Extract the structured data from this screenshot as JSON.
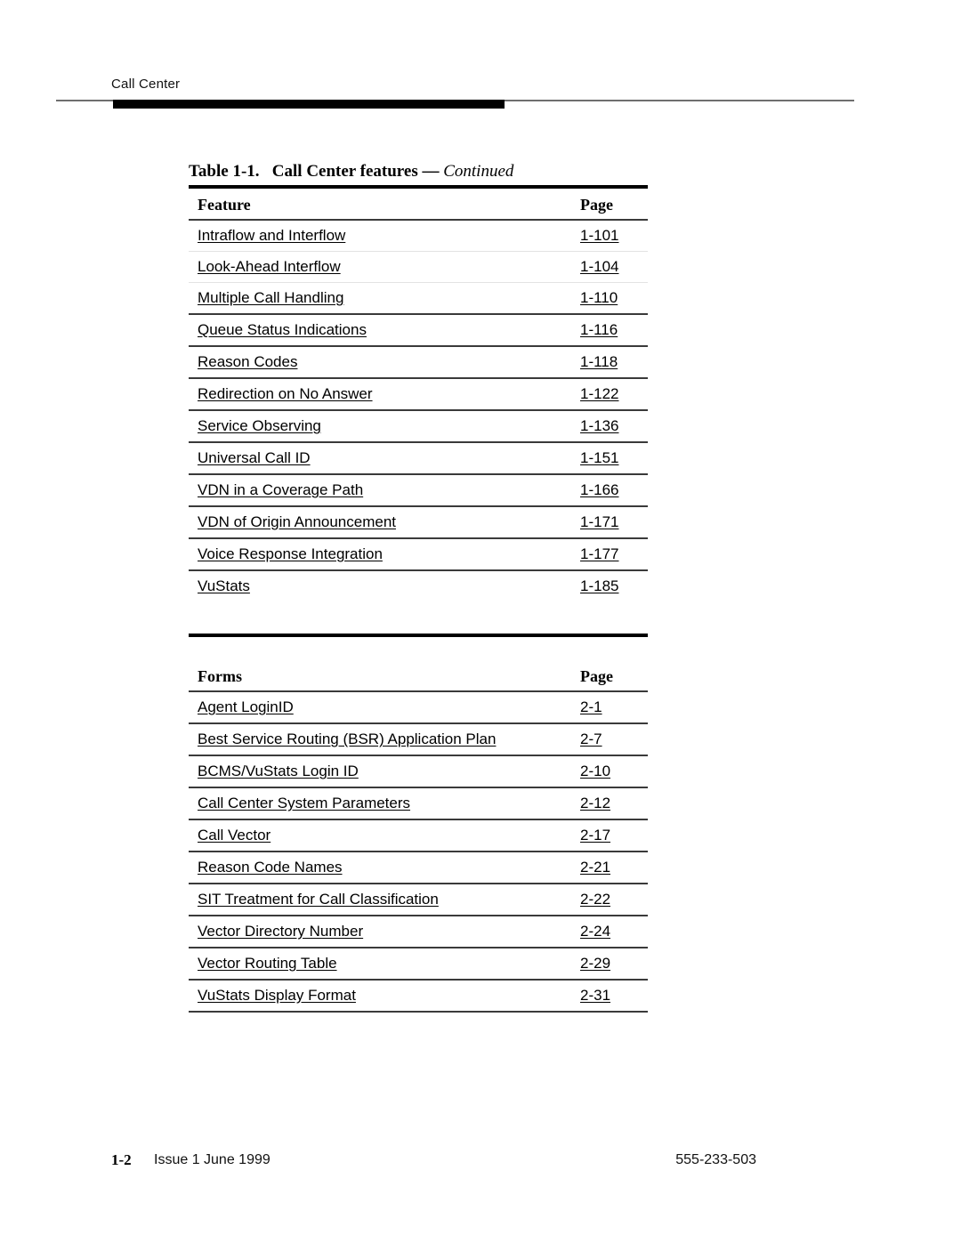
{
  "page": {
    "running_head": "Call Center",
    "footer": {
      "page_number": "1-2",
      "issue": "Issue 1 June 1999",
      "doc_number": "555-233-503"
    }
  },
  "features_table": {
    "caption_number": "Table 1-1.",
    "caption_title": "Call Center features",
    "caption_dash": "—",
    "caption_continued": "Continued",
    "columns": {
      "feature": "Feature",
      "page": "Page"
    },
    "rows": [
      {
        "feature": "Intraflow and Interflow",
        "page": "1-101"
      },
      {
        "feature": "Look-Ahead Interflow",
        "page": "1-104"
      },
      {
        "feature": "Multiple Call Handling",
        "page": "1-110"
      },
      {
        "feature": "Queue Status Indications",
        "page": "1-116"
      },
      {
        "feature": "Reason Codes",
        "page": "1-118"
      },
      {
        "feature": "Redirection on No Answer",
        "page": "1-122"
      },
      {
        "feature": "Service Observing",
        "page": "1-136"
      },
      {
        "feature": "Universal Call ID",
        "page": "1-151"
      },
      {
        "feature": "VDN in a Coverage Path",
        "page": "1-166"
      },
      {
        "feature": "VDN of Origin Announcement",
        "page": "1-171"
      },
      {
        "feature": "Voice Response Integration",
        "page": "1-177"
      },
      {
        "feature": "VuStats",
        "page": "1-185"
      }
    ]
  },
  "forms_table": {
    "columns": {
      "forms": "Forms",
      "page": "Page"
    },
    "rows": [
      {
        "form": "Agent LoginID",
        "page": "2-1"
      },
      {
        "form": "Best Service Routing (BSR) Application Plan",
        "page": "2-7"
      },
      {
        "form": "BCMS/VuStats Login ID",
        "page": "2-10"
      },
      {
        "form": "Call Center System Parameters",
        "page": "2-12"
      },
      {
        "form": "Call Vector",
        "page": "2-17"
      },
      {
        "form": "Reason Code Names",
        "page": "2-21"
      },
      {
        "form": "SIT Treatment for Call Classification",
        "page": "2-22"
      },
      {
        "form": "Vector Directory Number",
        "page": "2-24"
      },
      {
        "form": "Vector Routing Table",
        "page": "2-29"
      },
      {
        "form": "VuStats Display Format",
        "page": "2-31"
      }
    ]
  }
}
